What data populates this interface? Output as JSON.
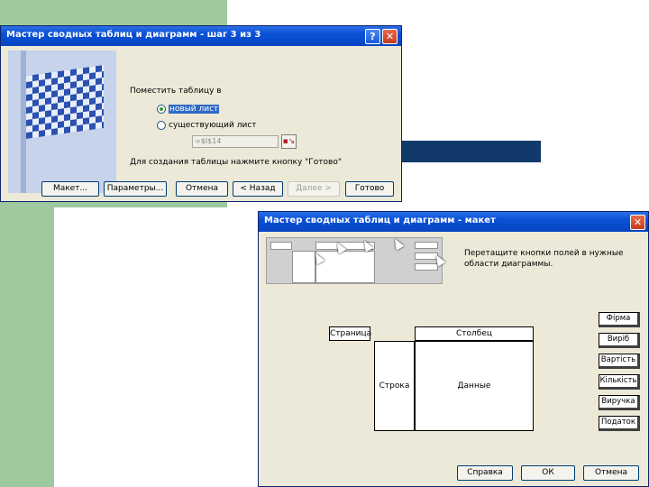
{
  "wizard_step3": {
    "title": "Мастер сводных таблиц и диаграмм - шаг 3 из 3",
    "question": "Поместить таблицу в",
    "option_new_sheet": "новый лист",
    "option_existing_sheet": "существующий лист",
    "range_value": "=$I$14",
    "hint": "Для создания таблицы нажмите кнопку \"Готово\"",
    "buttons": {
      "layout": "Макет...",
      "options": "Параметры...",
      "cancel": "Отмена",
      "back": "< Назад",
      "next": "Далее >",
      "finish": "Готово"
    },
    "help_glyph": "?",
    "close_glyph": "✕"
  },
  "layout_dialog": {
    "title": "Мастер сводных таблиц и диаграмм - макет",
    "instruction": "Перетащите кнопки полей в нужные области диаграммы.",
    "areas": {
      "page": "Страница",
      "column": "Столбец",
      "row": "Строка",
      "data": "Данные"
    },
    "fields": [
      "Фірма",
      "Виріб",
      "Вартість",
      "Кількість",
      "Виручка",
      "Податок"
    ],
    "buttons": {
      "help": "Справка",
      "ok": "ОК",
      "cancel": "Отмена"
    },
    "close_glyph": "✕"
  },
  "colors": {
    "background_band": "#9ec99e",
    "accent_bar": "#113a6b",
    "titlebar": "#0a50d6"
  }
}
